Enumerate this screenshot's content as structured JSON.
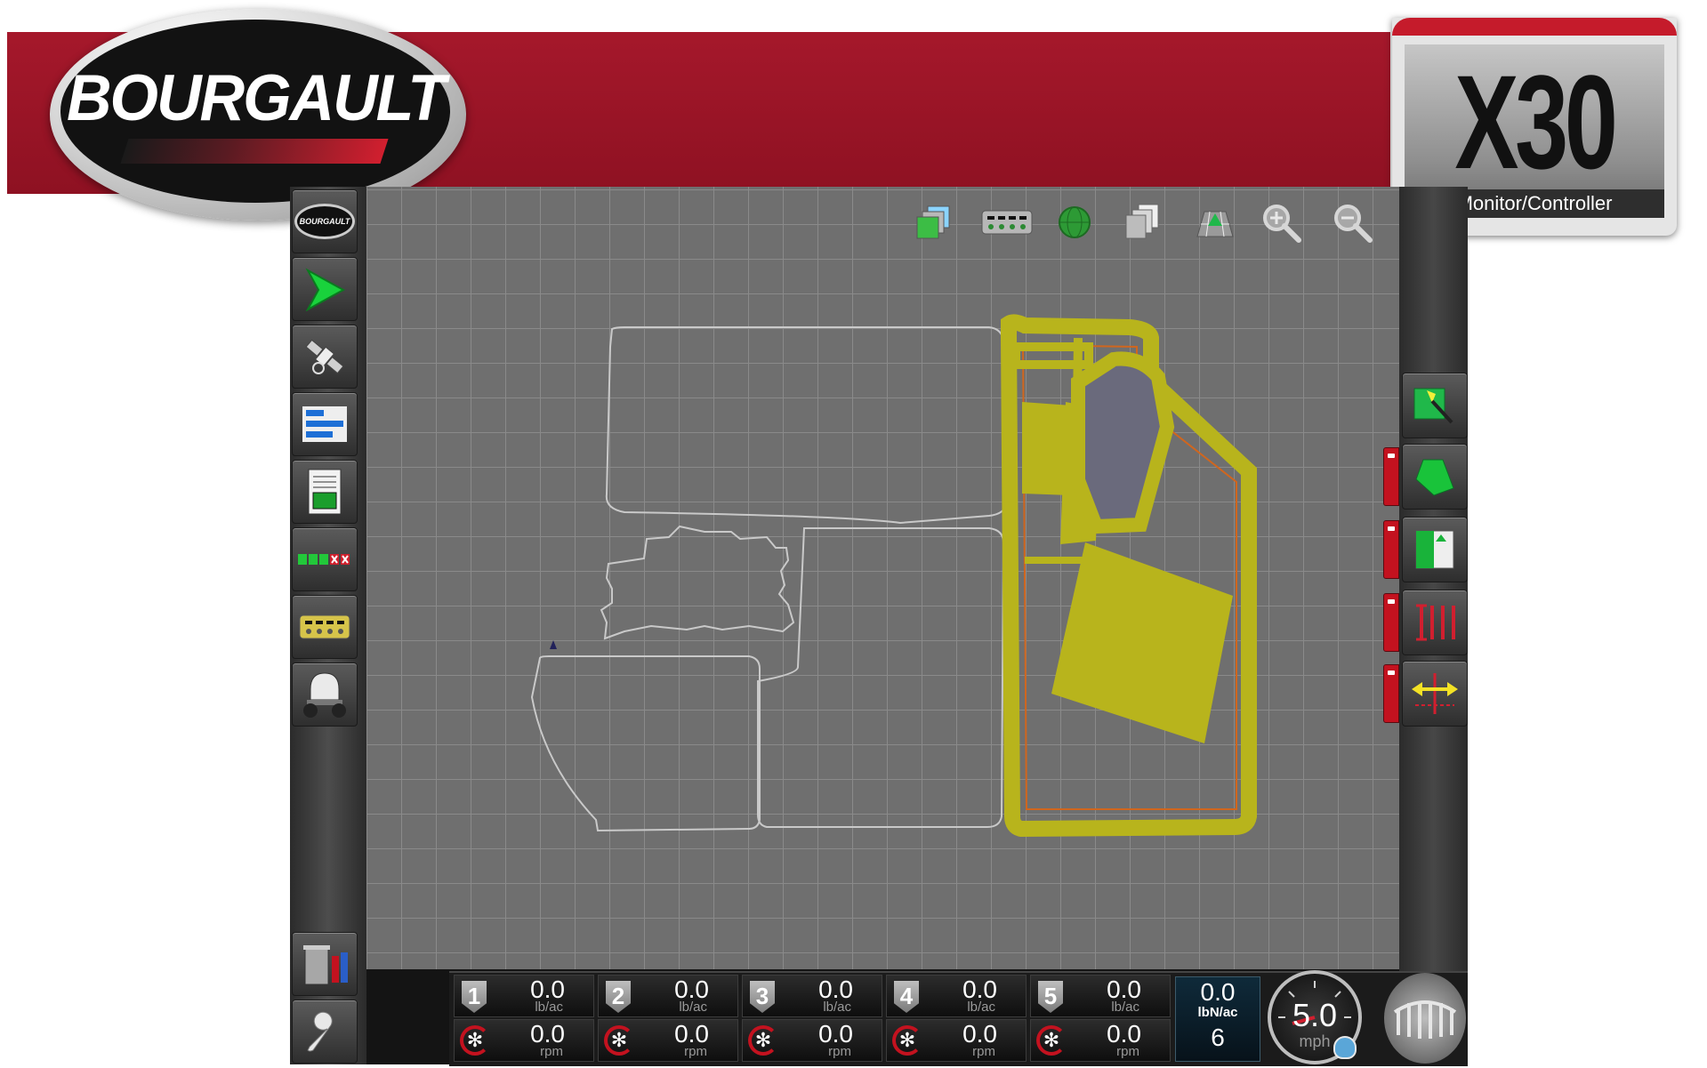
{
  "brand": {
    "name": "BOURGAULT",
    "model": "X30",
    "model_subtitle": "Monitor/Controller",
    "colors": {
      "banner_red": "#a5182b",
      "accent_red": "#c3121f",
      "coverage_yellow": "#b8b41c"
    }
  },
  "left_nav": [
    {
      "name": "bourgault-home-button",
      "icon": "bourgault-badge-icon",
      "label": "BOURGAULT"
    },
    {
      "name": "guidance-button",
      "icon": "green-arrow-icon"
    },
    {
      "name": "gps-button",
      "icon": "satellite-icon"
    },
    {
      "name": "implement-settings-button",
      "icon": "bars-icon"
    },
    {
      "name": "job-report-button",
      "icon": "document-icon"
    },
    {
      "name": "sections-button",
      "icon": "section-status-icon"
    },
    {
      "name": "products-button",
      "icon": "metering-icon"
    },
    {
      "name": "tank-button",
      "icon": "tank-icon"
    },
    {
      "name": "data-management-button",
      "icon": "trash-usb-icon"
    },
    {
      "name": "system-setup-button",
      "icon": "wrench-icon"
    }
  ],
  "map_toolbar": [
    {
      "name": "layers-button",
      "icon": "layers-icon"
    },
    {
      "name": "product-display-button",
      "icon": "metering-icon"
    },
    {
      "name": "gps-status-button",
      "icon": "globe-icon"
    },
    {
      "name": "view-toggle-button",
      "icon": "stacked-pages-icon"
    },
    {
      "name": "perspective-view-button",
      "icon": "3d-view-icon"
    },
    {
      "name": "zoom-in-button",
      "icon": "zoom-in-icon"
    },
    {
      "name": "zoom-out-button",
      "icon": "zoom-out-icon"
    }
  ],
  "right_nav": [
    {
      "name": "field-map-button",
      "icon": "field-map-icon"
    },
    {
      "name": "boundary-button",
      "icon": "boundary-icon"
    },
    {
      "name": "headland-button",
      "icon": "headland-icon"
    },
    {
      "name": "section-control-button",
      "icon": "section-control-icon"
    },
    {
      "name": "guidance-line-button",
      "icon": "guidance-line-icon"
    }
  ],
  "products": [
    {
      "id": "1",
      "rate": "0.0",
      "rate_unit": "lb/ac",
      "speed": "0.0",
      "speed_unit": "rpm"
    },
    {
      "id": "2",
      "rate": "0.0",
      "rate_unit": "lb/ac",
      "speed": "0.0",
      "speed_unit": "rpm"
    },
    {
      "id": "3",
      "rate": "0.0",
      "rate_unit": "lb/ac",
      "speed": "0.0",
      "speed_unit": "rpm"
    },
    {
      "id": "4",
      "rate": "0.0",
      "rate_unit": "lb/ac",
      "speed": "0.0",
      "speed_unit": "rpm"
    },
    {
      "id": "5",
      "rate": "0.0",
      "rate_unit": "lb/ac",
      "speed": "0.0",
      "speed_unit": "rpm"
    }
  ],
  "nitrogen": {
    "rate": "0.0",
    "unit": "lbN/ac",
    "product": "6"
  },
  "speed": {
    "value": "5.0",
    "unit": "mph"
  }
}
